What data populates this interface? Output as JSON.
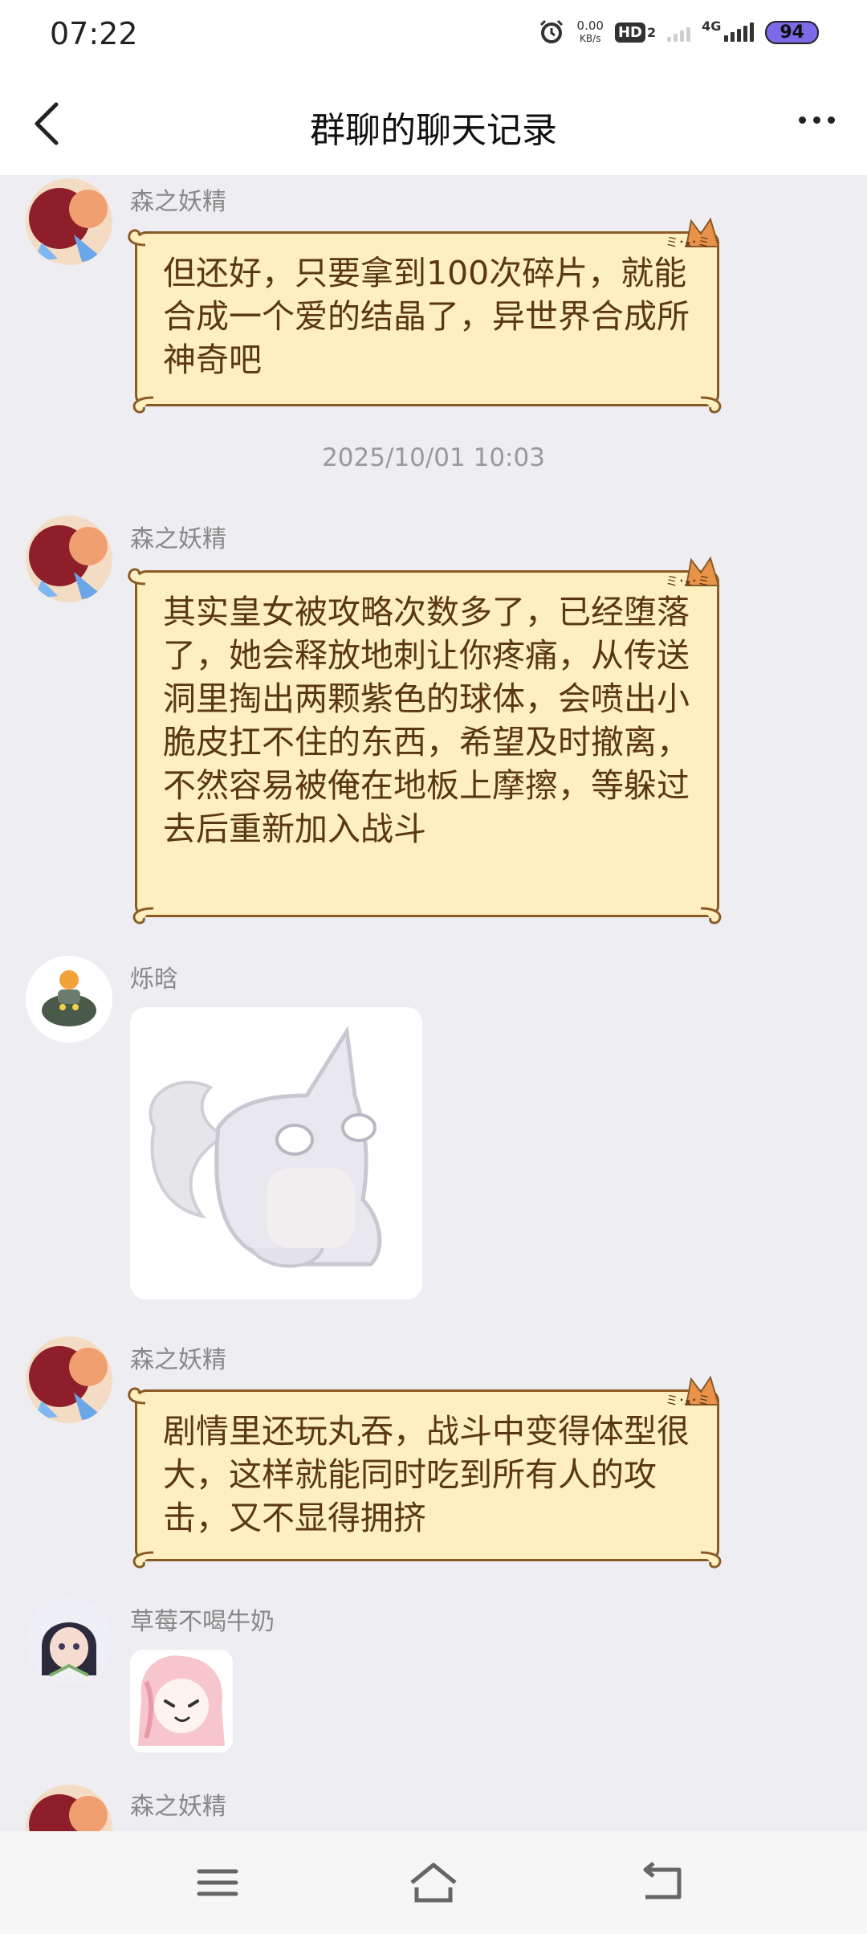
{
  "status": {
    "time": "07:22",
    "net_speed_value": "0.00",
    "net_speed_unit": "KB/s",
    "hd_label": "HD",
    "hd_sub": "2",
    "net_type": "4G",
    "battery": "94"
  },
  "header": {
    "title": "群聊的聊天记录"
  },
  "messages": [
    {
      "sender": "森之妖精",
      "text": "但还好，只要拿到100次碎片，就能合成一个爱的结晶了，异世界合成所 神奇吧"
    },
    {
      "timestamp": "2025/10/01 10:03"
    },
    {
      "sender": "森之妖精",
      "text": "其实皇女被攻略次数多了，已经堕落了，她会释放地刺让你疼痛，从传送洞里掏出两颗紫色的球体，会喷出小脆皮扛不住的东西，希望及时撤离，不然容易被俺在地板上摩擦，等躲过去后重新加入战斗"
    },
    {
      "sender": "烁晗"
    },
    {
      "sender": "森之妖精",
      "text": "剧情里还玩丸吞，战斗中变得体型很大，这样就能同时吃到所有人的攻击，又不显得拥挤"
    },
    {
      "sender": "草莓不喝牛奶"
    },
    {
      "sender": "森之妖精"
    }
  ],
  "colors": {
    "bubble_fill": "#fdefbf",
    "bubble_border": "#8a5a25",
    "bubble_text": "#5a3714",
    "background": "#eeeef2"
  },
  "icons": [
    "back-arrow-icon",
    "more-dots-icon",
    "alarm-icon",
    "menu-icon",
    "home-icon",
    "back-nav-icon"
  ]
}
